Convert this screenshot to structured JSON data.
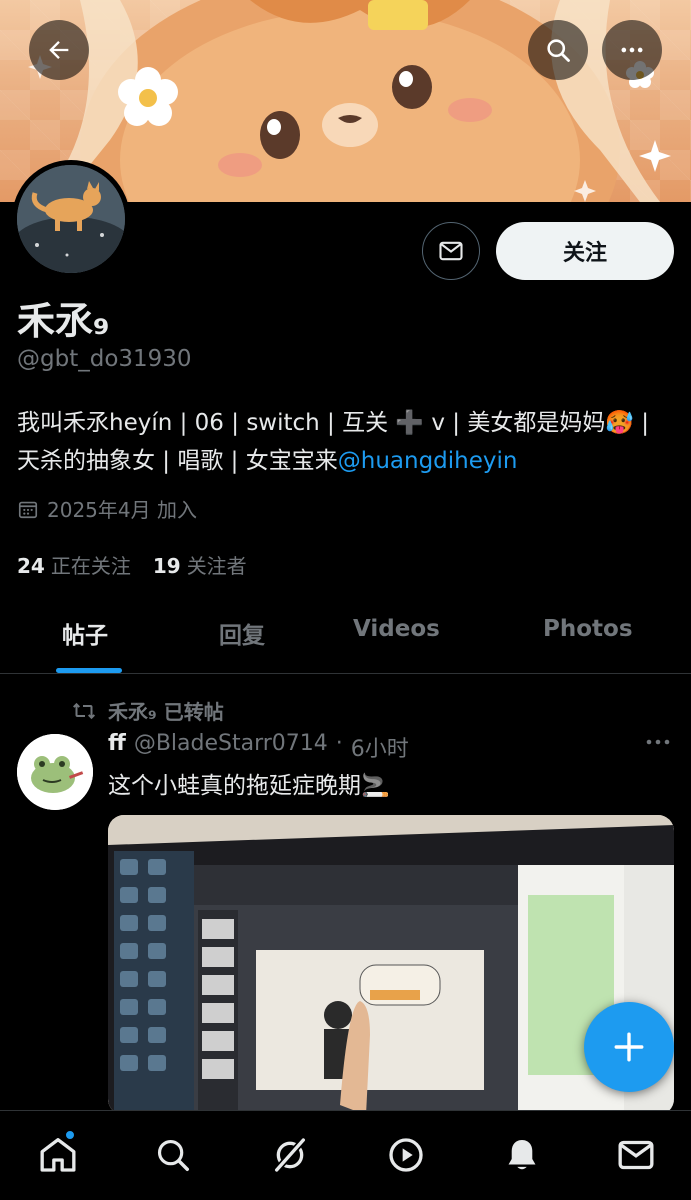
{
  "header": {
    "back_icon": "arrow-left-icon",
    "search_icon": "search-icon",
    "more_icon": "more-horizontal-icon"
  },
  "profile": {
    "name": "禾氶₉",
    "handle": "@gbt_do31930",
    "bio_text": "我叫禾氶heyín | 06 | switch | 互关 ➕ v | 美女都是妈妈🥵 | 天杀的抽象女 | 唱歌 | 女宝宝来",
    "bio_link": "@huangdiheyin",
    "joined": "2025年4月 加入",
    "following_count": "24",
    "following_label": "正在关注",
    "followers_count": "19",
    "followers_label": "关注者",
    "follow_button": "关注",
    "message_icon": "mail-icon"
  },
  "tabs": [
    {
      "label": "帖子",
      "active": true
    },
    {
      "label": "回复",
      "active": false
    },
    {
      "label": "Videos",
      "active": false
    },
    {
      "label": "Photos",
      "active": false
    }
  ],
  "post": {
    "repost_label": "禾氶₉ 已转帖",
    "author_name": "ff",
    "author_handle": "@BladeStarr0714",
    "separator": "·",
    "time": "6小时",
    "text": "这个小蛙真的拖延症晚期🚬",
    "media_alt": "laptop screen photo"
  },
  "bottom_nav": [
    {
      "icon": "home-icon",
      "active": true
    },
    {
      "icon": "search-icon"
    },
    {
      "icon": "grok-icon"
    },
    {
      "icon": "play-icon"
    },
    {
      "icon": "bell-icon"
    },
    {
      "icon": "mail-icon"
    }
  ],
  "colors": {
    "accent": "#1d9bf0",
    "background": "#000000",
    "secondary_text": "#71767b"
  }
}
